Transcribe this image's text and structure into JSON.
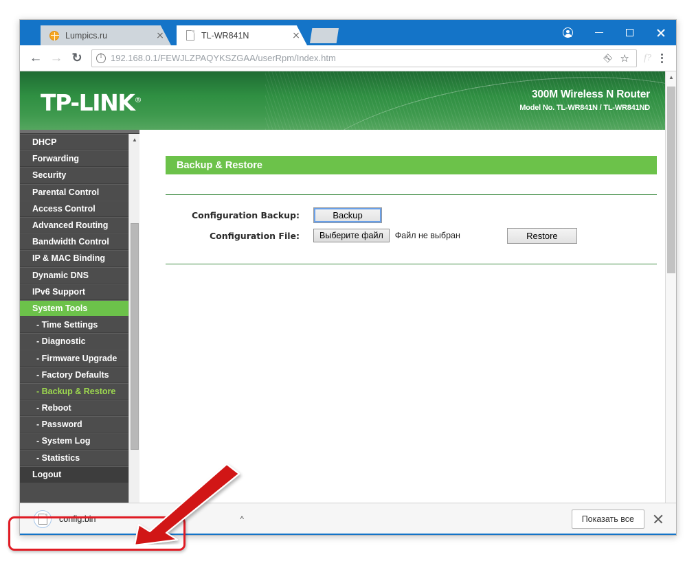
{
  "browser": {
    "tabs": [
      {
        "title": "Lumpics.ru",
        "favicon": "orange-circle-icon",
        "active": false
      },
      {
        "title": "TL-WR841N",
        "favicon": "document-icon",
        "active": true
      }
    ],
    "window_controls": {
      "profile": "profile-icon",
      "minimize": "minimize-icon",
      "maximize": "maximize-icon",
      "close": "close-icon"
    },
    "toolbar": {
      "back": "back-arrow-icon",
      "forward": "forward-arrow-icon",
      "reload": "reload-icon",
      "info_icon": "info-icon",
      "url_host": "192.168.0.1",
      "url_path": "/FEWJLZPAQYKSZGAA/userRpm/Index.htm",
      "key_icon": "key-icon",
      "star_icon": "star-bookmark-icon",
      "extension_icon": "f?",
      "menu_icon": "three-dot-menu-icon"
    }
  },
  "router": {
    "logo": "TP-LINK",
    "logo_mark": "®",
    "model_title": "300M Wireless N Router",
    "model_sub": "Model No. TL-WR841N / TL-WR841ND",
    "menu": [
      {
        "label": "DHCP",
        "type": "top",
        "state": "normal"
      },
      {
        "label": "Forwarding",
        "type": "top",
        "state": "normal"
      },
      {
        "label": "Security",
        "type": "top",
        "state": "normal"
      },
      {
        "label": "Parental Control",
        "type": "top",
        "state": "normal"
      },
      {
        "label": "Access Control",
        "type": "top",
        "state": "normal"
      },
      {
        "label": "Advanced Routing",
        "type": "top",
        "state": "normal"
      },
      {
        "label": "Bandwidth Control",
        "type": "top",
        "state": "normal"
      },
      {
        "label": "IP & MAC Binding",
        "type": "top",
        "state": "normal"
      },
      {
        "label": "Dynamic DNS",
        "type": "top",
        "state": "normal"
      },
      {
        "label": "IPv6 Support",
        "type": "top",
        "state": "normal"
      },
      {
        "label": "System Tools",
        "type": "top",
        "state": "selected"
      },
      {
        "label": "- Time Settings",
        "type": "sub",
        "state": "normal"
      },
      {
        "label": "- Diagnostic",
        "type": "sub",
        "state": "normal"
      },
      {
        "label": "- Firmware Upgrade",
        "type": "sub",
        "state": "normal"
      },
      {
        "label": "- Factory Defaults",
        "type": "sub",
        "state": "normal"
      },
      {
        "label": "- Backup & Restore",
        "type": "sub",
        "state": "current"
      },
      {
        "label": "- Reboot",
        "type": "sub",
        "state": "normal"
      },
      {
        "label": "- Password",
        "type": "sub",
        "state": "normal"
      },
      {
        "label": "- System Log",
        "type": "sub",
        "state": "normal"
      },
      {
        "label": "- Statistics",
        "type": "sub",
        "state": "normal"
      },
      {
        "label": "Logout",
        "type": "logout",
        "state": "normal"
      }
    ],
    "panel": {
      "title": "Backup & Restore",
      "backup_label": "Configuration Backup:",
      "backup_button": "Backup",
      "file_label": "Configuration File:",
      "file_choose_button": "Выберите файл",
      "file_status": "Файл не выбран",
      "restore_button": "Restore"
    },
    "accent_green": "#6cc24a",
    "header_green": "#2f8f42"
  },
  "download_shelf": {
    "file_name": "config.bin",
    "file_icon": "document-icon",
    "caret": "^",
    "show_all_button": "Показать все",
    "close_icon": "close-icon"
  },
  "annotation": {
    "highlight_color": "#e01b24",
    "arrow": "down-left-arrow"
  }
}
